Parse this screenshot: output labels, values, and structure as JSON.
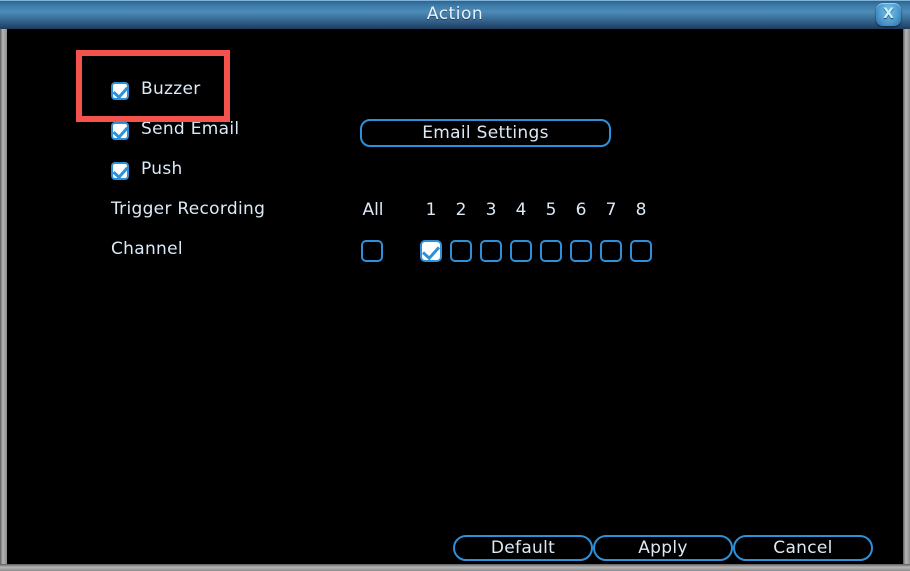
{
  "window": {
    "title": "Action",
    "close_icon": "close-x-icon",
    "close_label": "X"
  },
  "form": {
    "rows": [
      {
        "label": "Buzzer",
        "checked": true
      },
      {
        "label": "Send Email",
        "checked": true
      },
      {
        "label": "Push",
        "checked": true
      },
      {
        "label": "Trigger Recording",
        "checked": null
      },
      {
        "label": "Channel",
        "checked": null
      }
    ],
    "email_settings_label": "Email Settings",
    "all_label": "All",
    "channel_numbers": [
      "1",
      "2",
      "3",
      "4",
      "5",
      "6",
      "7",
      "8"
    ],
    "all_checked": false,
    "channel_checked": [
      true,
      false,
      false,
      false,
      false,
      false,
      false,
      false
    ]
  },
  "footer": {
    "default_label": "Default",
    "apply_label": "Apply",
    "cancel_label": "Cancel"
  },
  "annotation": {
    "highlight_target": "Buzzer",
    "highlight_color": "#f4524d"
  },
  "colors": {
    "accent_blue": "#2e90d8",
    "text": "#dce9f7",
    "titlebar_blue": "#4d8cb8",
    "background": "#000000"
  }
}
